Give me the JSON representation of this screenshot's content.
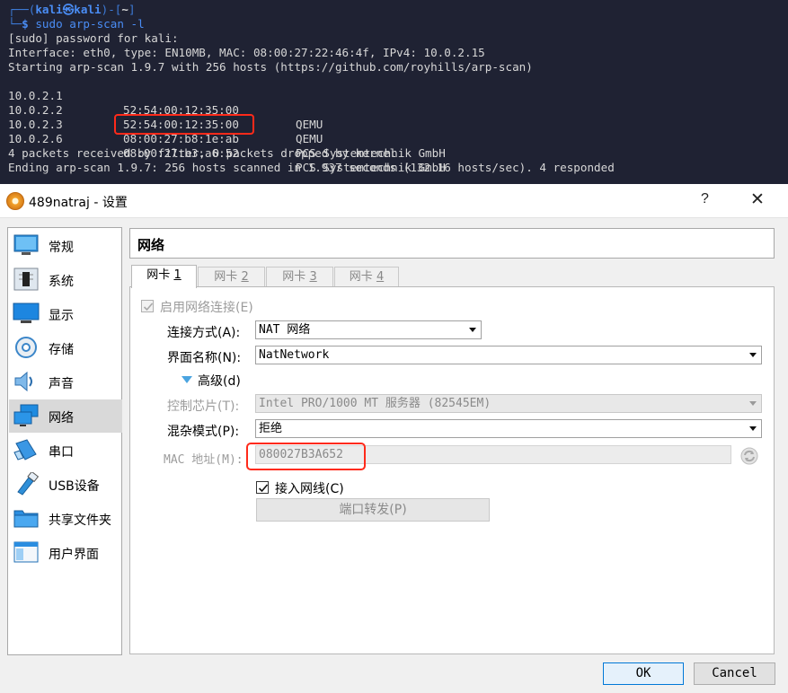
{
  "terminal": {
    "prompt_user": "kali",
    "prompt_at": "㉿",
    "prompt_host": "kali",
    "prompt_dir": "~",
    "command": "sudo arp-scan -l",
    "lines": [
      "[sudo] password for kali:",
      "Interface: eth0, type: EN10MB, MAC: 08:00:27:22:46:4f, IPv4: 10.0.2.15",
      "Starting arp-scan 1.9.7 with 256 hosts (https://github.com/royhills/arp-scan)"
    ],
    "hosts": [
      {
        "ip": "10.0.2.1",
        "mac": "52:54:00:12:35:00",
        "vendor": "QEMU"
      },
      {
        "ip": "10.0.2.2",
        "mac": "52:54:00:12:35:00",
        "vendor": "QEMU"
      },
      {
        "ip": "10.0.2.3",
        "mac": "08:00:27:b8:1e:ab",
        "vendor": "PCS Systemtechnik GmbH"
      },
      {
        "ip": "10.0.2.6",
        "mac": "08:00:27:b3:a6:52",
        "vendor": "PCS Systemtechnik GmbH"
      }
    ],
    "footer": [
      "4 packets received by filter, 0 packets dropped by kernel",
      "Ending arp-scan 1.9.7: 256 hosts scanned in 1.937 seconds (132.16 hosts/sec). 4 responded"
    ]
  },
  "dialog": {
    "title": "489natraj - 设置",
    "help": "?",
    "close": "✕",
    "sidebar": [
      {
        "label": "常规",
        "icon": "general-icon"
      },
      {
        "label": "系统",
        "icon": "system-icon"
      },
      {
        "label": "显示",
        "icon": "display-icon"
      },
      {
        "label": "存储",
        "icon": "storage-icon"
      },
      {
        "label": "声音",
        "icon": "audio-icon"
      },
      {
        "label": "网络",
        "icon": "network-icon",
        "selected": true
      },
      {
        "label": "串口",
        "icon": "serial-port-icon"
      },
      {
        "label": "USB设备",
        "icon": "usb-icon"
      },
      {
        "label": "共享文件夹",
        "icon": "shared-folder-icon"
      },
      {
        "label": "用户界面",
        "icon": "user-interface-icon"
      }
    ],
    "section_title": "网络",
    "tabs": [
      {
        "label": "网卡",
        "num": "1",
        "active": true
      },
      {
        "label": "网卡",
        "num": "2"
      },
      {
        "label": "网卡",
        "num": "3"
      },
      {
        "label": "网卡",
        "num": "4"
      }
    ],
    "form": {
      "enable_label": "启用网络连接(E)",
      "enable_checked": true,
      "attach_label": "连接方式(A):",
      "attach_value": "NAT 网络",
      "name_label": "界面名称(N):",
      "name_value": "NatNetwork",
      "advanced_label": "高级(d)",
      "adapter_label": "控制芯片(T):",
      "adapter_value": "Intel PRO/1000 MT 服务器 (82545EM)",
      "promisc_label": "混杂模式(P):",
      "promisc_value": "拒绝",
      "mac_label": "MAC 地址(M):",
      "mac_value": "080027B3A652",
      "cable_label": "接入网线(C)",
      "cable_checked": true,
      "port_forward_label": "端口转发(P)"
    },
    "buttons": {
      "ok": "OK",
      "cancel": "Cancel"
    }
  },
  "colors": {
    "terminal_bg": "#1f2233",
    "prompt_blue": "#4a8df5",
    "highlight_red": "#ff2a1a",
    "ok_border": "#0078d7"
  }
}
